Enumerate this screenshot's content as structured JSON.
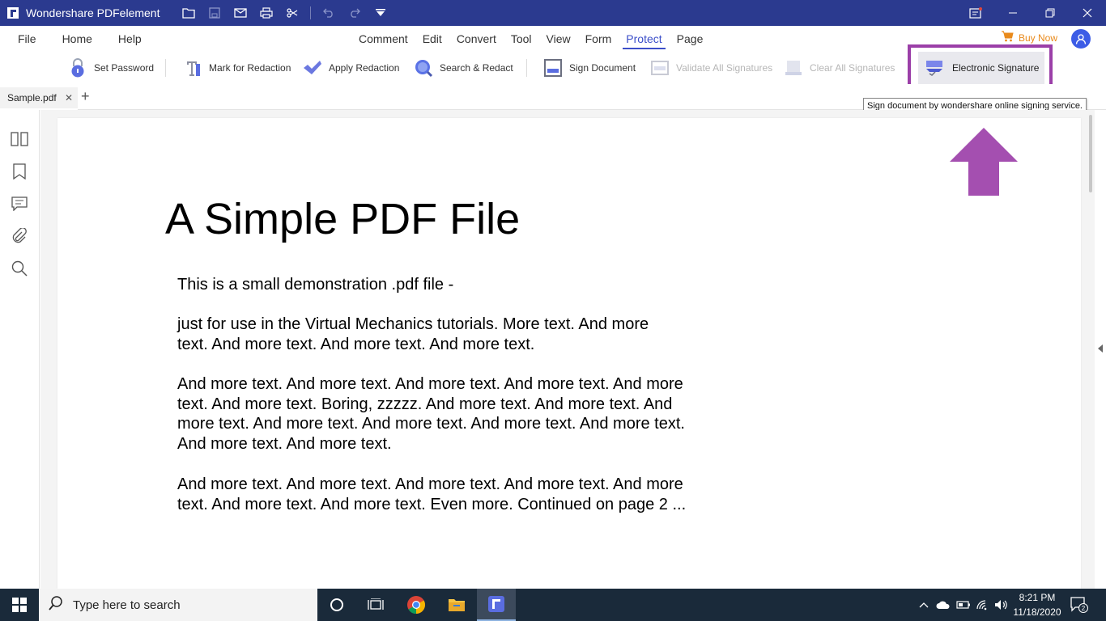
{
  "app": {
    "title": "Wondershare PDFelement"
  },
  "menu": {
    "left": [
      "File",
      "Home",
      "Help"
    ],
    "tabs": [
      "Comment",
      "Edit",
      "Convert",
      "Tool",
      "View",
      "Form",
      "Protect",
      "Page"
    ],
    "active_tab": "Protect",
    "buy_now": "Buy Now"
  },
  "toolbar": {
    "set_password": "Set Password",
    "mark_for_redaction": "Mark for Redaction",
    "apply_redaction": "Apply Redaction",
    "search_redact": "Search & Redact",
    "sign_document": "Sign Document",
    "validate_all_signatures": "Validate All Signatures",
    "clear_all_signatures": "Clear All Signatures",
    "electronic_signature": "Electronic Signature"
  },
  "tabs": {
    "doc_name": "Sample.pdf",
    "close": "✕",
    "add": "+"
  },
  "tooltip": "Sign document by wondershare online signing service.",
  "document": {
    "title": "A Simple PDF File",
    "paragraphs": [
      [
        "This is a small demonstration .pdf file -"
      ],
      [
        "just for use in the Virtual Mechanics tutorials. More text. And more",
        "text. And more text. And more text. And more text."
      ],
      [
        "And more text. And more text. And more text. And more text. And more",
        "text. And more text. Boring, zzzzz. And more text. And more text. And",
        "more text. And more text. And more text. And more text. And more text.",
        "And more text. And more text."
      ],
      [
        "And more text. And more text. And more text. And more text. And more",
        "text. And more text. And more text. Even more. Continued on page 2 ..."
      ]
    ]
  },
  "taskbar": {
    "search_placeholder": "Type here to search",
    "time": "8:21 PM",
    "date": "11/18/2020",
    "notification_count": "2"
  },
  "colors": {
    "titlebar": "#2b3a8f",
    "accent": "#3c4fc9",
    "highlight_box": "#9b3fa8",
    "arrow": "#a44fb0",
    "buy_now": "#e98a1b"
  }
}
